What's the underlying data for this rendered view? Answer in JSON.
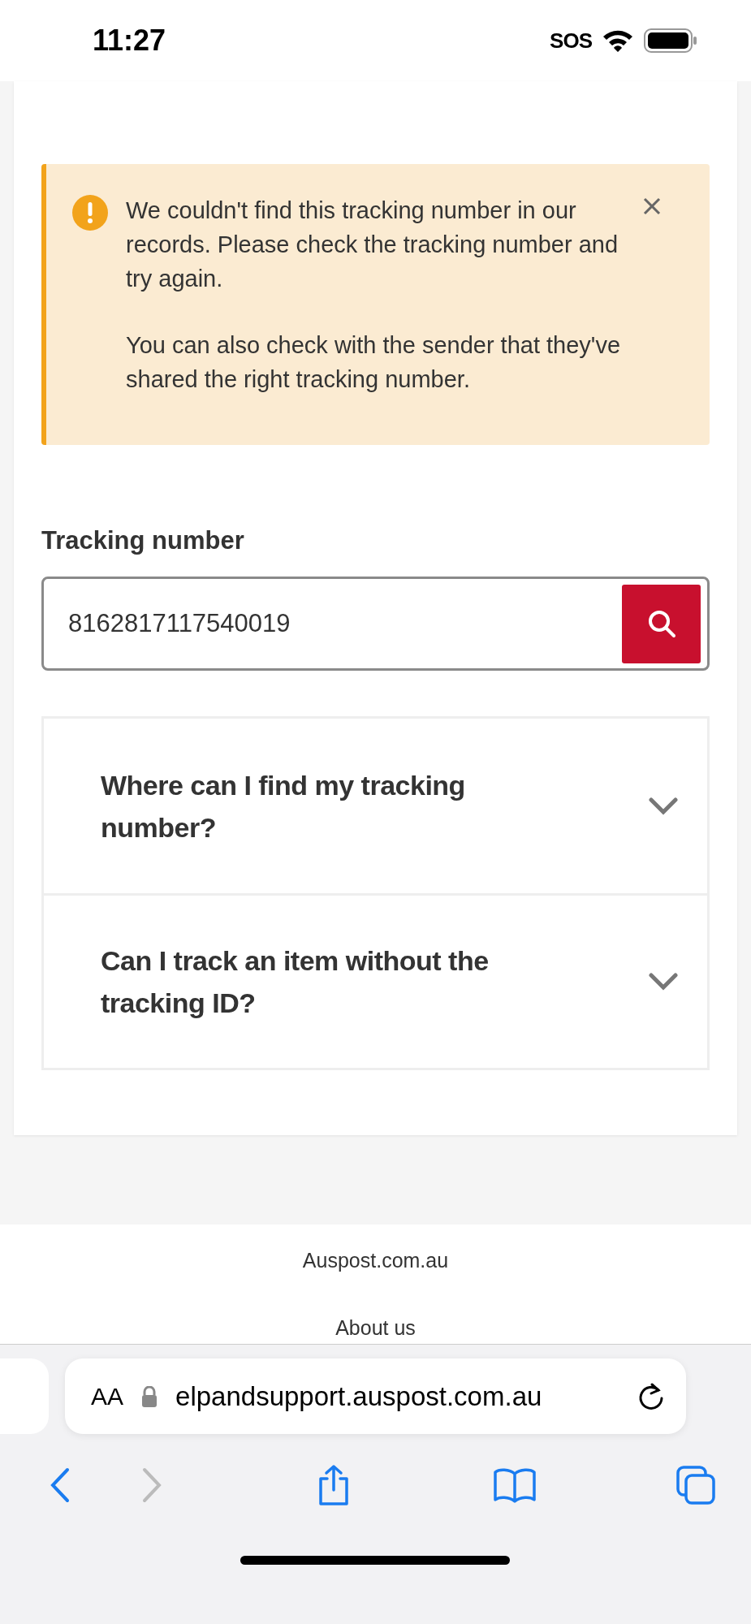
{
  "status_bar": {
    "time": "11:27",
    "carrier": "SOS"
  },
  "alert": {
    "paragraphs": [
      "We couldn't find this tracking number in our records. Please check the tracking number and try again.",
      "You can also check with the sender that they've shared the right tracking number."
    ]
  },
  "tracking": {
    "label": "Tracking number",
    "value": "8162817117540019"
  },
  "faq": [
    {
      "question": "Where can I find my tracking number?",
      "expanded": false
    },
    {
      "question": "Can I track an item without the tracking ID?",
      "expanded": false
    }
  ],
  "footer": {
    "links": [
      "Auspost.com.au",
      "About us"
    ]
  },
  "browser": {
    "text_size": "AA",
    "url": "elpandsupport.auspost.com.au",
    "forward_disabled": true
  }
}
